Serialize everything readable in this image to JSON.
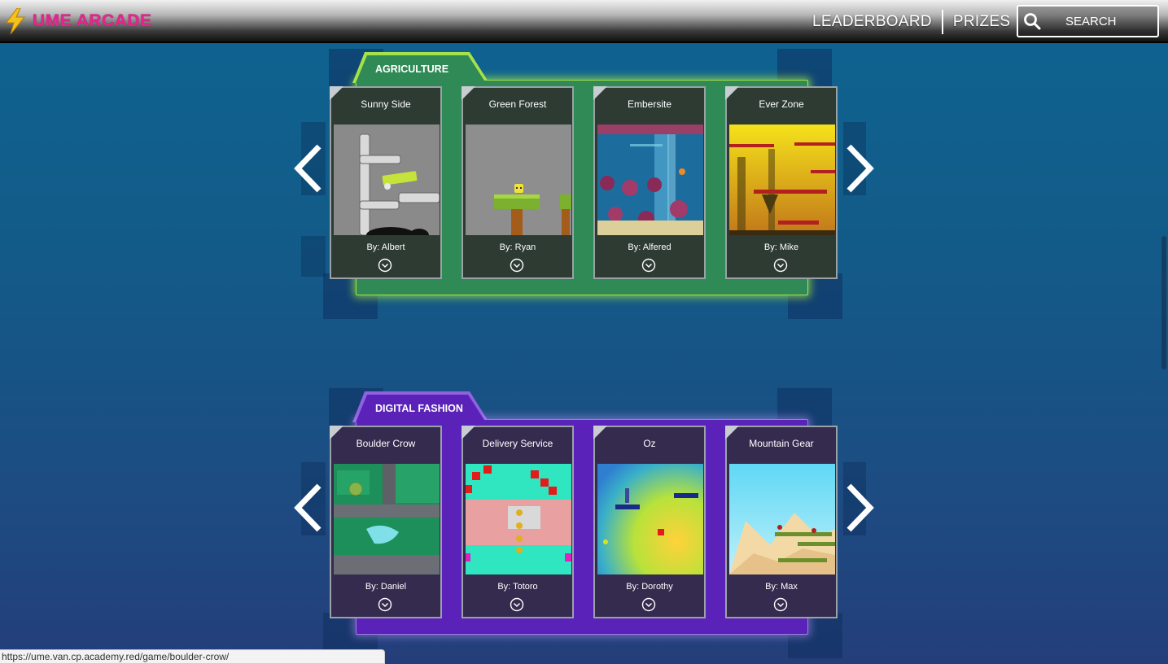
{
  "header": {
    "logo_text": "UME ARCADE",
    "nav": {
      "leaderboard": "LEADERBOARD",
      "prizes": "PRIZES"
    },
    "search": {
      "placeholder": "SEARCH"
    },
    "colors": {
      "logo": "#e8248f",
      "bolt": "#f5c21b"
    }
  },
  "categories": [
    {
      "name": "AGRICULTURE",
      "accent": "#2f8a55",
      "games": [
        {
          "title": "Sunny Side",
          "author": "By: Albert"
        },
        {
          "title": "Green Forest",
          "author": "By: Ryan"
        },
        {
          "title": "Embersite",
          "author": "By: Alfered"
        },
        {
          "title": "Ever Zone",
          "author": "By: Mike"
        }
      ]
    },
    {
      "name": "DIGITAL FASHION",
      "accent": "#5a22b8",
      "games": [
        {
          "title": "Boulder Crow",
          "author": "By: Daniel"
        },
        {
          "title": "Delivery Service",
          "author": "By: Totoro"
        },
        {
          "title": "Oz",
          "author": "By: Dorothy"
        },
        {
          "title": "Mountain Gear",
          "author": "By: Max"
        }
      ]
    }
  ],
  "status_bar": {
    "url": "https://ume.van.cp.academy.red/game/boulder-crow/"
  },
  "icons": {
    "logo": "lightning-bolt-icon",
    "search": "magnifier-icon",
    "expand": "chevron-down-circle-icon",
    "prev": "chevron-left-icon",
    "next": "chevron-right-icon"
  }
}
